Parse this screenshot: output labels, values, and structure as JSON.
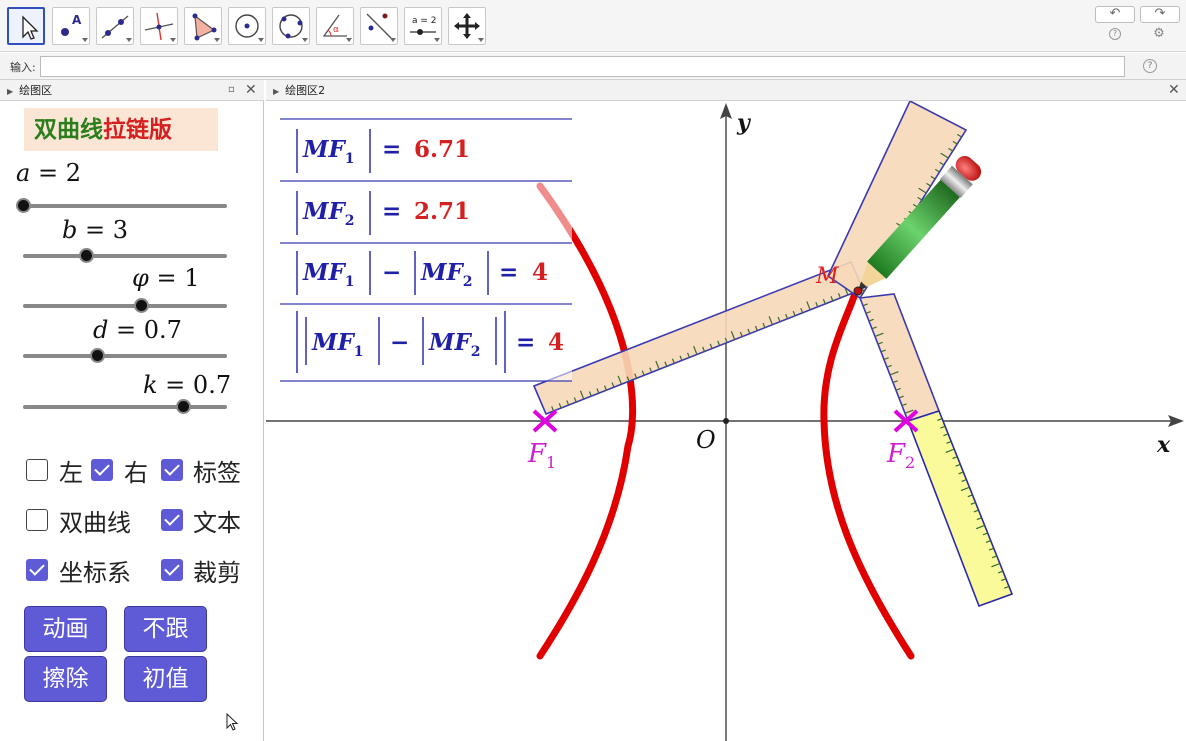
{
  "toolbar": {
    "tools": [
      "move-tool-icon",
      "point-tool-icon",
      "line-tool-icon",
      "perpendicular-tool-icon",
      "polygon-tool-icon",
      "circle-center-tool-icon",
      "circle-three-points-tool-icon",
      "angle-tool-icon",
      "reflect-tool-icon",
      "slider-tool-icon",
      "move-graphics-view-icon"
    ],
    "slider_icon_text": "a = 2",
    "undo_symbol": "↶",
    "redo_symbol": "↷",
    "help_symbol": "?",
    "settings_symbol": "⚙"
  },
  "input_bar": {
    "label": "输入:",
    "value": "",
    "help_symbol": "?"
  },
  "left_panel": {
    "title": "绘图区",
    "heading_part1": "双曲线",
    "heading_part2": "拉链版",
    "sliders": [
      {
        "var": "a",
        "eq": " = ",
        "val": "2",
        "level": 0.0
      },
      {
        "var": "b",
        "eq": " = ",
        "val": "3",
        "level": 0.33
      },
      {
        "var": "φ",
        "eq": " = ",
        "val": "1",
        "level": 0.62
      },
      {
        "var": "d",
        "eq": " = ",
        "val": "0.7",
        "level": 0.39
      },
      {
        "var": "k",
        "eq": " = ",
        "val": "0.7",
        "level": 0.84
      }
    ],
    "checkboxes": [
      {
        "label": "左",
        "checked": false
      },
      {
        "label": "右",
        "checked": true
      },
      {
        "label": "标签",
        "checked": true
      },
      {
        "label": "双曲线",
        "checked": false
      },
      {
        "label": "文本",
        "checked": true
      },
      {
        "label": "坐标系",
        "checked": true
      },
      {
        "label": "裁剪",
        "checked": true
      }
    ],
    "buttons": [
      "动画",
      "不跟",
      "擦除",
      "初值"
    ]
  },
  "graphics2": {
    "title": "绘图区2",
    "axis_x": "x",
    "axis_y": "y",
    "origin": "O",
    "point_M": "M",
    "F1": "F",
    "F1_sub": "1",
    "F2": "F",
    "F2_sub": "2",
    "table": [
      {
        "lhs": "MF",
        "sub": "1",
        "rest": "",
        "val": "6.71"
      },
      {
        "lhs": "MF",
        "sub": "2",
        "rest": "",
        "val": "2.71"
      },
      {
        "lhs": "MF",
        "sub": "1",
        "mid": "MF",
        "sub2": "2",
        "val": "4"
      },
      {
        "lhs": "MF",
        "sub": "1",
        "mid": "MF",
        "sub2": "2",
        "val": "4"
      }
    ],
    "colors": {
      "curve": "#e00000",
      "label_blue": "#1f1fa8",
      "value_red": "#d42020",
      "ruler_fill": "#f7d8b8",
      "ruler_yellow": "#fafa9a",
      "magenta": "#e000e0"
    }
  }
}
